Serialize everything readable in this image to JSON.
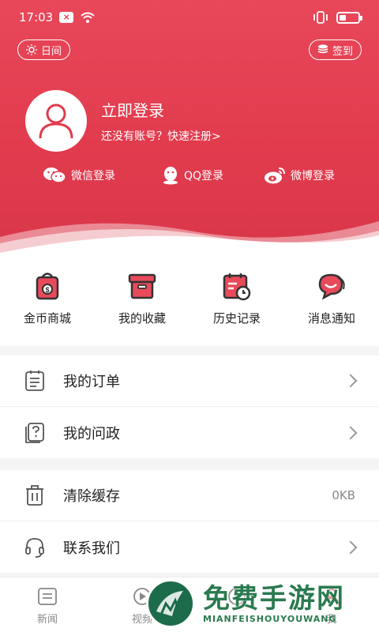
{
  "status": {
    "time": "17:03"
  },
  "header": {
    "day_mode_label": "日间",
    "sign_in_label": "签到",
    "login_title": "立即登录",
    "register_prompt": "还没有账号？快速注册>",
    "social": {
      "wechat": "微信登录",
      "qq": "QQ登录",
      "weibo": "微博登录"
    }
  },
  "quick_actions": [
    {
      "label": "金币商城",
      "icon": "coin-bag-icon"
    },
    {
      "label": "我的收藏",
      "icon": "box-icon"
    },
    {
      "label": "历史记录",
      "icon": "calendar-clock-icon"
    },
    {
      "label": "消息通知",
      "icon": "chat-bubble-icon"
    }
  ],
  "list_a": [
    {
      "label": "我的订单",
      "icon": "order-list-icon"
    },
    {
      "label": "我的问政",
      "icon": "question-doc-icon"
    }
  ],
  "list_b": [
    {
      "label": "清除缓存",
      "icon": "trash-icon",
      "value": "0KB"
    },
    {
      "label": "联系我们",
      "icon": "headset-icon"
    }
  ],
  "bottom_nav": [
    {
      "label": "新闻",
      "icon": "news-icon"
    },
    {
      "label": "视频",
      "icon": "video-icon"
    },
    {
      "label": "",
      "icon": "service-icon"
    },
    {
      "label": "我",
      "icon": "me-icon"
    }
  ],
  "watermark": {
    "title": "免费手游网",
    "subtitle": "MIANFEISHOUYOUWANG"
  },
  "colors": {
    "brand_red": "#e23b4e",
    "accent_green": "#2a7a4f"
  }
}
